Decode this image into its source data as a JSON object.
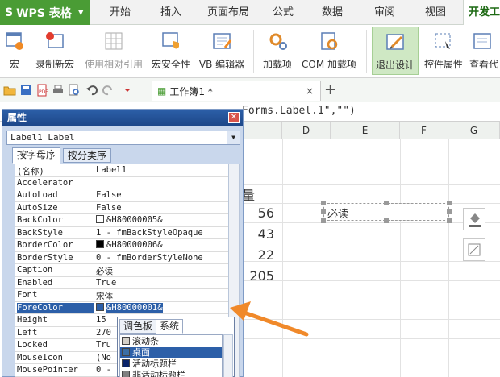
{
  "app": {
    "name": "WPS 表格"
  },
  "tabs": [
    "开始",
    "插入",
    "页面布局",
    "公式",
    "数据",
    "审阅",
    "视图",
    "开发工"
  ],
  "ribbon": {
    "buttons": [
      {
        "label": "宏",
        "icon": "macro-icon"
      },
      {
        "label": "录制新宏",
        "icon": "record-macro-icon"
      },
      {
        "label": "使用相对引用",
        "icon": "relative-reference-icon"
      },
      {
        "label": "宏安全性",
        "icon": "macro-security-icon"
      },
      {
        "label": "VB 编辑器",
        "icon": "vb-editor-icon"
      },
      {
        "label": "加载项",
        "icon": "addins-icon"
      },
      {
        "label": "COM 加载项",
        "icon": "com-addins-icon"
      },
      {
        "label": "退出设计",
        "icon": "exit-design-icon"
      },
      {
        "label": "控件属性",
        "icon": "control-properties-icon"
      },
      {
        "label": "查看代",
        "icon": "view-code-icon"
      }
    ]
  },
  "document": {
    "tab_title": "工作簿1 *"
  },
  "formula": "Forms.Label.1\",\"\")",
  "grid": {
    "columns": [
      "D",
      "E",
      "F",
      "G"
    ],
    "header_fragment": "量",
    "values": [
      "56",
      "43",
      "22",
      "205"
    ],
    "label_text": "必读"
  },
  "properties": {
    "title": "属性",
    "object": "Label1 Label",
    "tab_alpha": "按字母序",
    "tab_category": "按分类序",
    "rows": [
      {
        "name": "(名称)",
        "value": "Label1"
      },
      {
        "name": "Accelerator",
        "value": ""
      },
      {
        "name": "AutoLoad",
        "value": "False"
      },
      {
        "name": "AutoSize",
        "value": "False"
      },
      {
        "name": "BackColor",
        "value": "&H80000005&",
        "swatch": "#ffffff"
      },
      {
        "name": "BackStyle",
        "value": "1 - fmBackStyleOpaque"
      },
      {
        "name": "BorderColor",
        "value": "&H80000006&",
        "swatch": "#000000"
      },
      {
        "name": "BorderStyle",
        "value": "0 - fmBorderStyleNone"
      },
      {
        "name": "Caption",
        "value": "必读"
      },
      {
        "name": "Enabled",
        "value": "True"
      },
      {
        "name": "Font",
        "value": "宋体"
      },
      {
        "name": "ForeColor",
        "value": "&H80000001&",
        "swatch": "#2c5fa8",
        "selected": true
      },
      {
        "name": "Height",
        "value": "15"
      },
      {
        "name": "Left",
        "value": "270"
      },
      {
        "name": "Locked",
        "value": "Tru"
      },
      {
        "name": "MouseIcon",
        "value": "(No"
      },
      {
        "name": "MousePointer",
        "value": "0 -"
      }
    ]
  },
  "color_popup": {
    "tab_palette": "调色板",
    "tab_system": "系统",
    "items": [
      {
        "label": "滚动条",
        "swatch": "#d4d0c8"
      },
      {
        "label": "桌面",
        "swatch": "#3a6ea5",
        "selected": true
      },
      {
        "label": "活动标题栏",
        "swatch": "#0a246a"
      },
      {
        "label": "非活动标题栏",
        "swatch": "#808080"
      }
    ]
  },
  "colors": {
    "accent": "#4a9c35",
    "selection": "#2c5fa8",
    "arrow": "#f0892a"
  }
}
